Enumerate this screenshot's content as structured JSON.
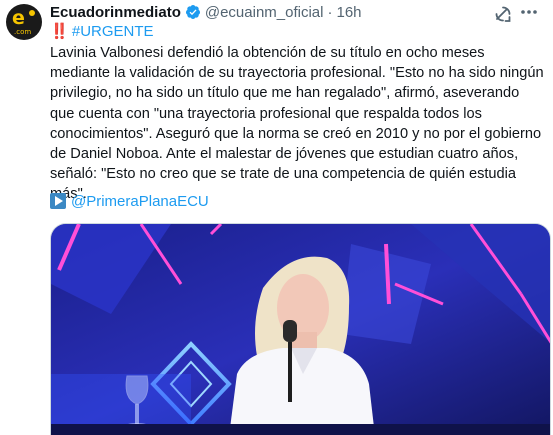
{
  "author": {
    "display_name": "Ecuadorinmediato",
    "handle": "@ecuainm_oficial",
    "separator": "·",
    "time": "16h",
    "avatar_text": "e",
    "avatar_subtext": ".com"
  },
  "post": {
    "urgent_marks": "‼️",
    "hashtag": "#URGENTE",
    "body": "Lavinia Valbonesi defendió la obtención de su título en ocho meses mediante la validación de su trayectoria profesional. \"Esto no ha sido ningún privilegio, no ha sido un título que me han regalado\", afirmó, aseverando que cuenta con \"una trayectoria profesional que respalda todos los conocimientos\". Aseguró que la norma se creó en 2010 y no por el gobierno de Daniel Noboa. Ante el malestar de jóvenes que estudian cuatro años, señaló: \"Esto no creo que se trate de una competencia de quién estudia más\".",
    "mention": "@PrimeraPlanaECU"
  },
  "icons": {
    "verified": "verified-badge-icon",
    "grok": "grok-icon",
    "more": "more-icon",
    "play": "play-button-icon"
  },
  "colors": {
    "link": "#1d9bf0",
    "verified": "#1d9bf0",
    "muted": "#536471",
    "urgent": "#d0021b"
  }
}
